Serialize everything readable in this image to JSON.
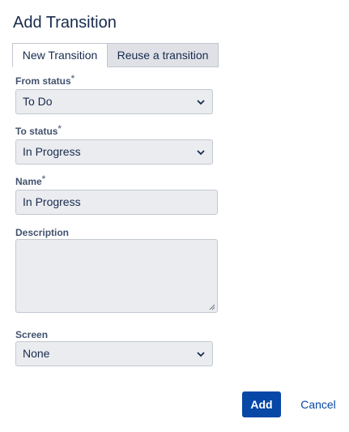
{
  "dialog": {
    "title": "Add Transition"
  },
  "tabs": [
    {
      "label": "New Transition",
      "active": true
    },
    {
      "label": "Reuse a transition",
      "active": false
    }
  ],
  "form": {
    "from_status": {
      "label": "From status",
      "required_mark": "*",
      "value": "To Do"
    },
    "to_status": {
      "label": "To status",
      "required_mark": "*",
      "value": "In Progress"
    },
    "name": {
      "label": "Name",
      "required_mark": "*",
      "value": "In Progress"
    },
    "description": {
      "label": "Description",
      "value": ""
    },
    "screen": {
      "label": "Screen",
      "value": "None"
    }
  },
  "buttons": {
    "add_label": "Add",
    "cancel_label": "Cancel"
  },
  "colors": {
    "primary": "#0747a6",
    "field_bg": "#ebecf0",
    "label": "#42526e"
  },
  "icons": {
    "select_chevron": "chevron-down-icon",
    "resize_grip": "resize-handle-icon"
  }
}
